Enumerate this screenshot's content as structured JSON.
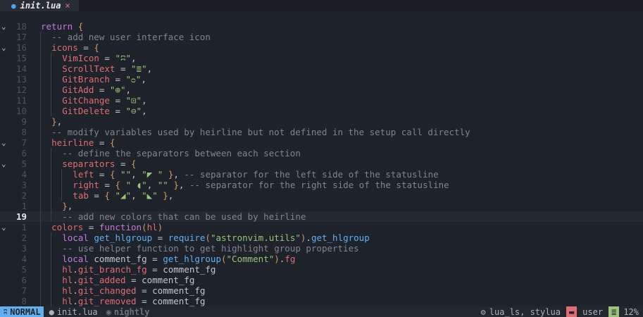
{
  "tab": {
    "icon": "lua-file-icon",
    "name": "init.lua",
    "close": "×"
  },
  "lines": [
    {
      "n": "18",
      "fold": "⌄",
      "indent": 0,
      "tokens": [
        [
          "kw",
          "return"
        ],
        [
          "op",
          " "
        ],
        [
          "pun",
          "{"
        ]
      ]
    },
    {
      "n": "17",
      "fold": "",
      "indent": 1,
      "tokens": [
        [
          "cm",
          "-- add new user interface icon"
        ]
      ]
    },
    {
      "n": "16",
      "fold": "⌄",
      "indent": 1,
      "tokens": [
        [
          "var",
          "icons"
        ],
        [
          "op",
          " = "
        ],
        [
          "pun",
          "{"
        ]
      ]
    },
    {
      "n": "15",
      "fold": "",
      "indent": 2,
      "tokens": [
        [
          "var",
          "VimIcon"
        ],
        [
          "op",
          " = "
        ],
        [
          "str",
          "\"ʭ\""
        ],
        [
          "op",
          ","
        ]
      ]
    },
    {
      "n": "14",
      "fold": "",
      "indent": 2,
      "tokens": [
        [
          "var",
          "ScrollText"
        ],
        [
          "op",
          " = "
        ],
        [
          "str",
          "\"≣\""
        ],
        [
          "op",
          ","
        ]
      ]
    },
    {
      "n": "13",
      "fold": "",
      "indent": 2,
      "tokens": [
        [
          "var",
          "GitBranch"
        ],
        [
          "op",
          " = "
        ],
        [
          "str",
          "\"ᴑ\""
        ],
        [
          "op",
          ","
        ]
      ]
    },
    {
      "n": "12",
      "fold": "",
      "indent": 2,
      "tokens": [
        [
          "var",
          "GitAdd"
        ],
        [
          "op",
          " = "
        ],
        [
          "str",
          "\"⊕\""
        ],
        [
          "op",
          ","
        ]
      ]
    },
    {
      "n": "11",
      "fold": "",
      "indent": 2,
      "tokens": [
        [
          "var",
          "GitChange"
        ],
        [
          "op",
          " = "
        ],
        [
          "str",
          "\"⊡\""
        ],
        [
          "op",
          ","
        ]
      ]
    },
    {
      "n": "10",
      "fold": "",
      "indent": 2,
      "tokens": [
        [
          "var",
          "GitDelete"
        ],
        [
          "op",
          " = "
        ],
        [
          "str",
          "\"⊖\""
        ],
        [
          "op",
          ","
        ]
      ]
    },
    {
      "n": "9",
      "fold": "",
      "indent": 1,
      "tokens": [
        [
          "pun",
          "}"
        ],
        [
          "op",
          ","
        ]
      ]
    },
    {
      "n": "8",
      "fold": "",
      "indent": 1,
      "tokens": [
        [
          "cm",
          "-- modify variables used by heirline but not defined in the setup call directly"
        ]
      ]
    },
    {
      "n": "7",
      "fold": "⌄",
      "indent": 1,
      "tokens": [
        [
          "var",
          "heirline"
        ],
        [
          "op",
          " = "
        ],
        [
          "pun",
          "{"
        ]
      ]
    },
    {
      "n": "6",
      "fold": "",
      "indent": 2,
      "tokens": [
        [
          "cm",
          "-- define the separators between each section"
        ]
      ]
    },
    {
      "n": "5",
      "fold": "⌄",
      "indent": 2,
      "tokens": [
        [
          "var",
          "separators"
        ],
        [
          "op",
          " = "
        ],
        [
          "pun",
          "{"
        ]
      ]
    },
    {
      "n": "4",
      "fold": "",
      "indent": 3,
      "tokens": [
        [
          "var",
          "left"
        ],
        [
          "op",
          " = "
        ],
        [
          "pun",
          "{"
        ],
        [
          "op",
          " "
        ],
        [
          "str",
          "\"\""
        ],
        [
          "op",
          ", "
        ],
        [
          "str",
          "\"◤ \""
        ],
        [
          "op",
          " "
        ],
        [
          "pun",
          "}"
        ],
        [
          "op",
          ", "
        ],
        [
          "cm",
          "-- separator for the left side of the statusline"
        ]
      ]
    },
    {
      "n": "3",
      "fold": "",
      "indent": 3,
      "tokens": [
        [
          "var",
          "right"
        ],
        [
          "op",
          " = "
        ],
        [
          "pun",
          "{"
        ],
        [
          "op",
          " "
        ],
        [
          "str",
          "\" ◖\""
        ],
        [
          "op",
          ", "
        ],
        [
          "str",
          "\"\""
        ],
        [
          "op",
          " "
        ],
        [
          "pun",
          "}"
        ],
        [
          "op",
          ", "
        ],
        [
          "cm",
          "-- separator for the right side of the statusline"
        ]
      ]
    },
    {
      "n": "2",
      "fold": "",
      "indent": 3,
      "tokens": [
        [
          "var",
          "tab"
        ],
        [
          "op",
          " = "
        ],
        [
          "pun",
          "{"
        ],
        [
          "op",
          " "
        ],
        [
          "str",
          "\"◢\""
        ],
        [
          "op",
          ", "
        ],
        [
          "str",
          "\"◣\""
        ],
        [
          "op",
          " "
        ],
        [
          "pun",
          "}"
        ],
        [
          "op",
          ","
        ]
      ]
    },
    {
      "n": "1",
      "fold": "",
      "indent": 2,
      "tokens": [
        [
          "pun",
          "}"
        ],
        [
          "op",
          ","
        ]
      ]
    },
    {
      "n": "19",
      "fold": "",
      "indent": 2,
      "cur": true,
      "tokens": [
        [
          "cm",
          "-- add new colors that can be used by heirline"
        ]
      ]
    },
    {
      "n": "1",
      "fold": "⌄",
      "indent": 1,
      "tokens": [
        [
          "var",
          "colors"
        ],
        [
          "op",
          " = "
        ],
        [
          "kw",
          "function"
        ],
        [
          "pun",
          "("
        ],
        [
          "var",
          "hl"
        ],
        [
          "pun",
          ")"
        ]
      ]
    },
    {
      "n": "2",
      "fold": "",
      "indent": 2,
      "tokens": [
        [
          "kw",
          "local"
        ],
        [
          "op",
          " "
        ],
        [
          "fn",
          "get_hlgroup"
        ],
        [
          "op",
          " = "
        ],
        [
          "fn",
          "require"
        ],
        [
          "pun",
          "("
        ],
        [
          "str",
          "\"astronvim.utils\""
        ],
        [
          "pun",
          ")"
        ],
        [
          "op",
          "."
        ],
        [
          "fn",
          "get_hlgroup"
        ]
      ]
    },
    {
      "n": "3",
      "fold": "",
      "indent": 2,
      "tokens": [
        [
          "cm",
          "-- use helper function to get highlight group properties"
        ]
      ]
    },
    {
      "n": "4",
      "fold": "",
      "indent": 2,
      "tokens": [
        [
          "kw",
          "local"
        ],
        [
          "op",
          " comment_fg = "
        ],
        [
          "fn",
          "get_hlgroup"
        ],
        [
          "pun",
          "("
        ],
        [
          "str",
          "\"Comment\""
        ],
        [
          "pun",
          ")"
        ],
        [
          "op",
          "."
        ],
        [
          "var",
          "fg"
        ]
      ]
    },
    {
      "n": "5",
      "fold": "",
      "indent": 2,
      "tokens": [
        [
          "var",
          "hl"
        ],
        [
          "op",
          "."
        ],
        [
          "var",
          "git_branch_fg"
        ],
        [
          "op",
          " = comment_fg"
        ]
      ]
    },
    {
      "n": "6",
      "fold": "",
      "indent": 2,
      "tokens": [
        [
          "var",
          "hl"
        ],
        [
          "op",
          "."
        ],
        [
          "var",
          "git_added"
        ],
        [
          "op",
          " = comment_fg"
        ]
      ]
    },
    {
      "n": "7",
      "fold": "",
      "indent": 2,
      "tokens": [
        [
          "var",
          "hl"
        ],
        [
          "op",
          "."
        ],
        [
          "var",
          "git_changed"
        ],
        [
          "op",
          " = comment_fg"
        ]
      ]
    },
    {
      "n": "8",
      "fold": "",
      "indent": 2,
      "tokens": [
        [
          "var",
          "hl"
        ],
        [
          "op",
          "."
        ],
        [
          "var",
          "git_removed"
        ],
        [
          "op",
          " = comment_fg"
        ]
      ]
    }
  ],
  "status": {
    "mode": "NORMAL",
    "file": "init.lua",
    "branch": "nightly",
    "lsp": "lua_ls, stylua",
    "user": "user",
    "percent": "12%"
  },
  "colors": {
    "accent": "#61afef",
    "string": "#98c379",
    "keyword": "#c678dd",
    "variable": "#e06c75"
  }
}
